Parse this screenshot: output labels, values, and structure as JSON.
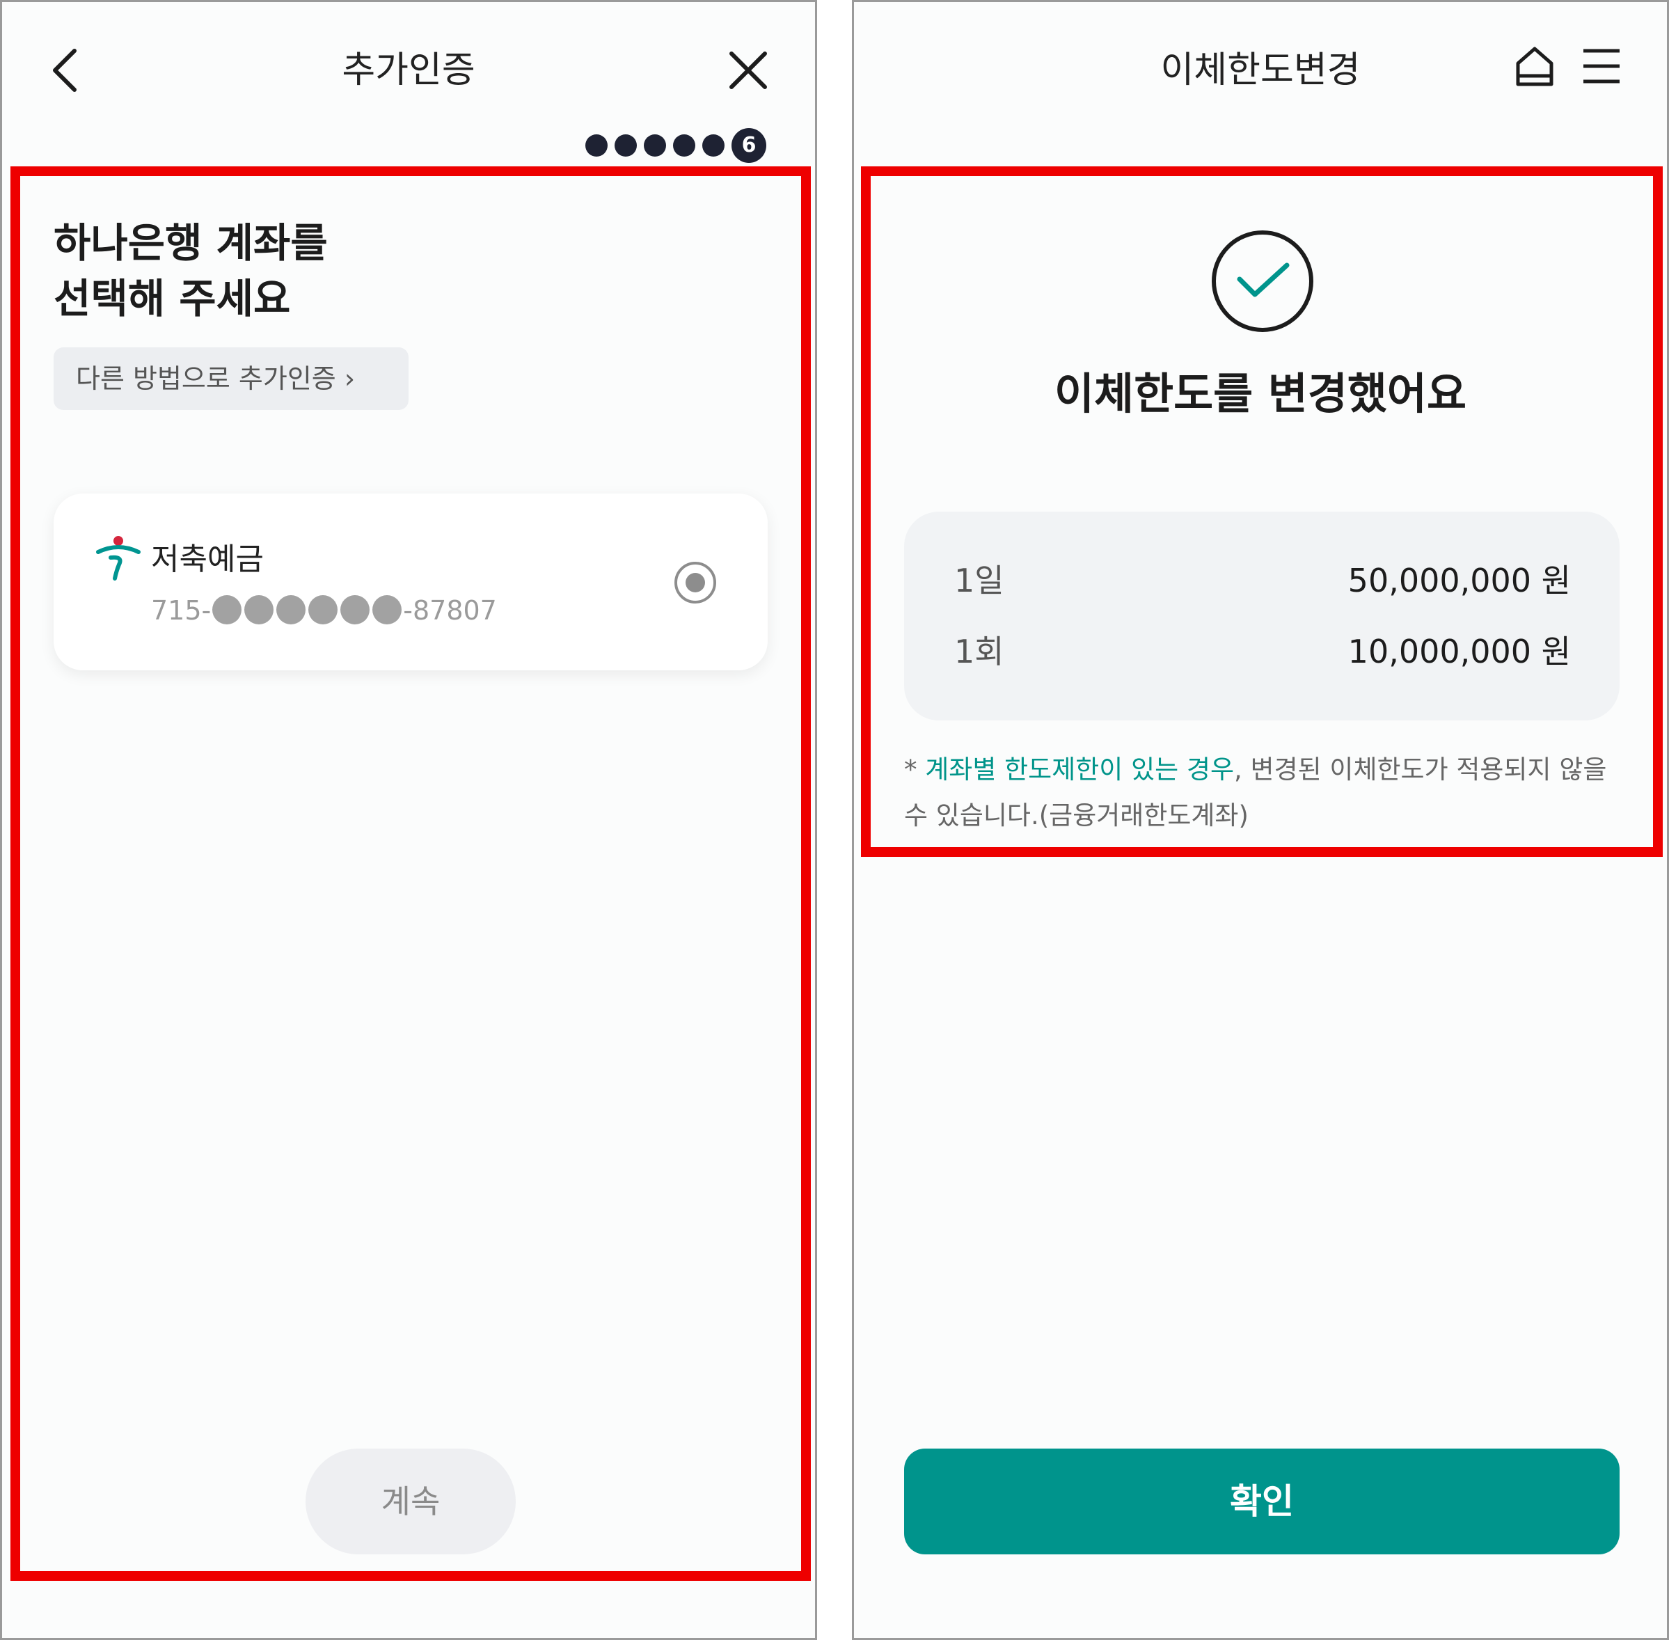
{
  "colors": {
    "accent": "#00948c",
    "highlight": "#ee0000",
    "dark": "#1e2233"
  },
  "left": {
    "header": {
      "title": "추가인증",
      "back_icon": "chevron-left-icon",
      "close_icon": "close-icon"
    },
    "steps": {
      "current": "6"
    },
    "heading": {
      "line1": "하나은행 계좌를",
      "line2": "선택해 주세요"
    },
    "other_method": "다른 방법으로 추가인증 ›",
    "account": {
      "name": "저축예금",
      "prefix": "715-",
      "suffix": "-87807",
      "bank_icon": "hana-bank-logo-icon"
    },
    "continue_label": "계속"
  },
  "right": {
    "header": {
      "title": "이체한도변경",
      "home_icon": "home-icon",
      "menu_icon": "menu-icon"
    },
    "done_title": "이체한도를 변경했어요",
    "limits": [
      {
        "label": "1일",
        "value": "50,000,000 원"
      },
      {
        "label": "1회",
        "value": "10,000,000 원"
      }
    ],
    "note": {
      "star": "* ",
      "accent": "계좌별 한도제한이 있는 경우",
      "rest": ", 변경된 이체한도가 적용되지 않을 수 있습니다.(금융거래한도계좌)"
    },
    "confirm_label": "확인"
  }
}
